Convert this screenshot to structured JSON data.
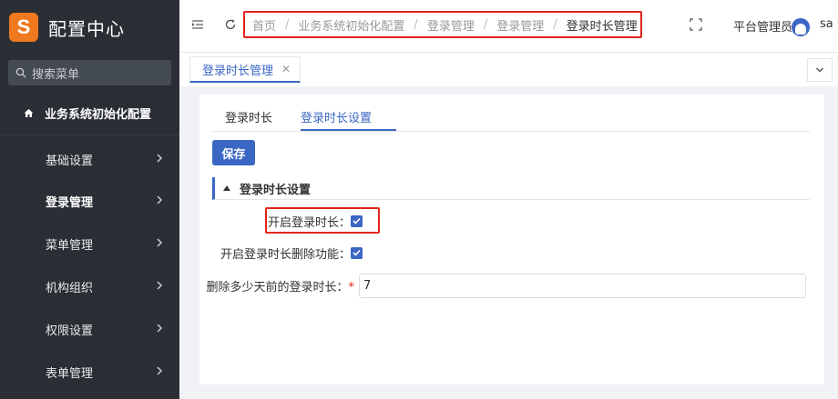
{
  "sidebar": {
    "app_title": "配置中心",
    "logo_letter": "S",
    "search_placeholder": "搜索菜单",
    "top_menu": "业务系统初始化配置",
    "items": [
      {
        "label": "基础设置"
      },
      {
        "label": "登录管理"
      },
      {
        "label": "菜单管理"
      },
      {
        "label": "机构组织"
      },
      {
        "label": "权限设置"
      },
      {
        "label": "表单管理"
      }
    ]
  },
  "header": {
    "breadcrumb": [
      "首页",
      "业务系统初始化配置",
      "登录管理",
      "登录管理",
      "登录时长管理"
    ],
    "breadcrumb_sep": "/",
    "user_role": "平台管理员",
    "user_name": "sa"
  },
  "tabbar": {
    "page_tab": "登录时长管理",
    "close": "✕"
  },
  "content": {
    "tabs": [
      {
        "label": "登录时长"
      },
      {
        "label": "登录时长设置"
      }
    ],
    "save_label": "保存",
    "section_title": "登录时长设置",
    "fields": {
      "enable_label": "开启登录时长：",
      "enable_checked": true,
      "delete_label": "开启登录时长删除功能：",
      "delete_checked": true,
      "days_label": "删除多少天前的登录时长：",
      "days_required_mark": "*",
      "days_value": "7"
    }
  },
  "colors": {
    "sidebar_bg": "#2b2f35",
    "accent": "#3b67c4",
    "logo": "#f0781e",
    "highlight": "#e0251b"
  }
}
